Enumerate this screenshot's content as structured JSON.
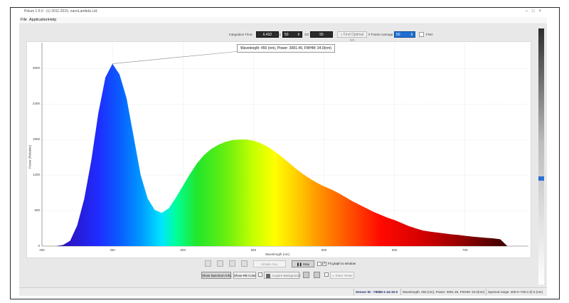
{
  "window": {
    "title": "Pelum 1.5.0 - (c) 2011-2015, nanoLambda Ltd.",
    "controls": [
      "–",
      "□",
      "×"
    ]
  },
  "menu": [
    "File",
    "Application",
    "Help"
  ],
  "controls": {
    "integration_time_label": "Integration Time:",
    "integration_time_value": "6.432",
    "unit_label": "(ms)",
    "gain_value": "50",
    "ss_label": "SS:",
    "ss_value": "55",
    "find_optimal_label": "Find Optimal SS",
    "frame_average_label": "# Frame Average:",
    "frame_average_value": "50",
    "fwa_label": "FWA"
  },
  "tooltip": "Wavelength: 450 (nm), Power: 3081.49, FWHM: 34.0(nm)",
  "toolbar": {
    "simple_acq": "Simple Acq.",
    "stop": "Stop",
    "fit_graph": "Fit graph to window",
    "show_spectrum_info": "Show Spectrum Info.",
    "show_rb_color": "Show RB Color",
    "acquire_background": "Acquire Background",
    "enter_tester": "Enter Tester"
  },
  "status": {
    "sensor": "Sensor ID : Y8585-1-44-15-0",
    "peak": "Wavelength: 450 (nm), Power: 3081.49, FWHM: 34.0(nm)",
    "range": "Spectral range: 400.0~730.0 @ 5 (nm)"
  },
  "chart_data": {
    "type": "area",
    "title": "",
    "xlabel": "Wavelength (nm)",
    "ylabel": "Power (Relative)",
    "xlim": [
      400,
      745
    ],
    "ylim": [
      0,
      3100
    ],
    "xticks": [
      400,
      450,
      500,
      550,
      600,
      650,
      700
    ],
    "yticks": [
      0,
      600,
      1200,
      1800,
      2400,
      3000,
      3600
    ],
    "grid": true,
    "fill": "wavelength-rainbow",
    "peak_annotation": {
      "x": 450,
      "y": 3081.49
    },
    "x": [
      400,
      410,
      415,
      420,
      425,
      430,
      435,
      440,
      445,
      450,
      455,
      460,
      465,
      470,
      475,
      480,
      485,
      490,
      495,
      500,
      505,
      510,
      515,
      520,
      525,
      530,
      535,
      540,
      545,
      550,
      555,
      560,
      565,
      570,
      575,
      580,
      585,
      590,
      595,
      600,
      605,
      610,
      615,
      620,
      625,
      630,
      635,
      640,
      645,
      650,
      655,
      660,
      665,
      670,
      675,
      680,
      685,
      690,
      695,
      700,
      705,
      710,
      715,
      720,
      725,
      730
    ],
    "y": [
      0,
      0,
      20,
      90,
      350,
      800,
      1450,
      2250,
      2850,
      3080,
      2900,
      2500,
      1850,
      1200,
      800,
      610,
      560,
      640,
      820,
      1020,
      1220,
      1400,
      1540,
      1640,
      1710,
      1760,
      1790,
      1800,
      1800,
      1780,
      1740,
      1680,
      1600,
      1510,
      1410,
      1310,
      1220,
      1140,
      1070,
      1010,
      960,
      900,
      830,
      760,
      700,
      640,
      580,
      530,
      480,
      440,
      390,
      340,
      300,
      265,
      245,
      230,
      215,
      200,
      190,
      175,
      160,
      150,
      140,
      130,
      115,
      0
    ]
  },
  "colors": {
    "accent": "#1e6fd1",
    "panel": "#e8e8e8",
    "status_text": "#1a2b6d"
  }
}
